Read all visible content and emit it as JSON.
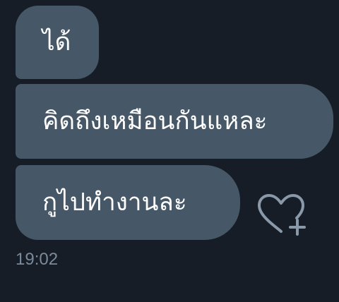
{
  "messages": [
    {
      "text": "ได้"
    },
    {
      "text": "คิดถึงเหมือนกันแหละ"
    },
    {
      "text": "กูไปทำงานละ"
    }
  ],
  "react_button": {
    "icon": "heart-plus-icon",
    "color": "#8a99a9"
  },
  "timestamp": "19:02",
  "colors": {
    "background": "#161d27",
    "bubble": "#465867",
    "bubble_text": "#ffffff",
    "timestamp": "#7b8a9a"
  }
}
